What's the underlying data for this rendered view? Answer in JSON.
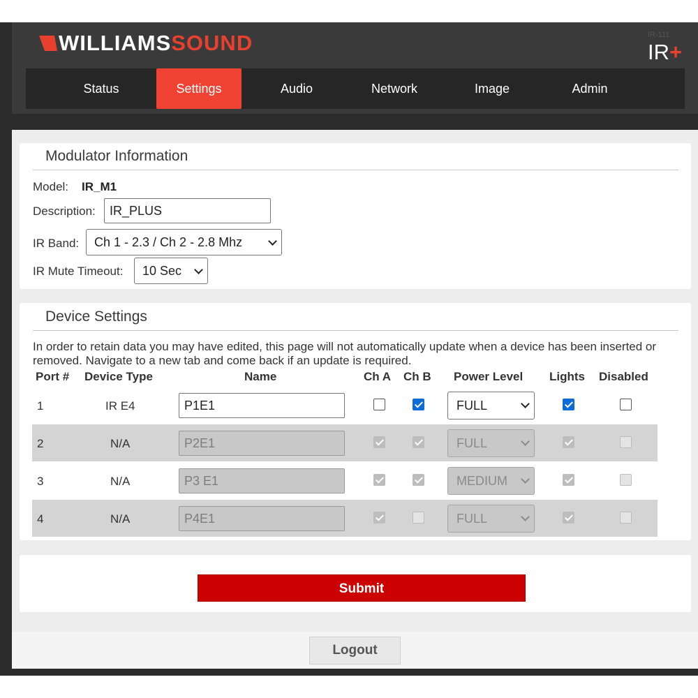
{
  "brand": {
    "logo_word1": "WILLIAMS",
    "logo_word2": "SOUND",
    "device_small": "IR-111",
    "device_badge": "IR",
    "device_badge_plus": "+",
    "accent_color": "#ef4233"
  },
  "nav": {
    "tabs": [
      {
        "label": "Status",
        "active": false
      },
      {
        "label": "Settings",
        "active": true
      },
      {
        "label": "Audio",
        "active": false
      },
      {
        "label": "Network",
        "active": false
      },
      {
        "label": "Image",
        "active": false
      },
      {
        "label": "Admin",
        "active": false
      }
    ]
  },
  "modulator": {
    "title": "Modulator Information",
    "model_label": "Model:",
    "model_value": "IR_M1",
    "description_label": "Description:",
    "description_value": "IR_PLUS",
    "ir_band_label": "IR Band:",
    "ir_band_value": "Ch 1 - 2.3 / Ch 2 - 2.8 Mhz",
    "mute_timeout_label": "IR Mute Timeout:",
    "mute_timeout_value": "10 Sec"
  },
  "devices": {
    "title": "Device Settings",
    "note": "In order to retain data you may have edited, this page will not automatically update when a device has been inserted or removed. Navigate to a new tab and come back if an update is required.",
    "headers": [
      "Port #",
      "Device Type",
      "Name",
      "Ch A",
      "Ch B",
      "Power Level",
      "Lights",
      "Disabled"
    ],
    "rows": [
      {
        "port": "1",
        "type": "IR E4",
        "name": "P1E1",
        "ch_a": false,
        "ch_b": true,
        "power": "FULL",
        "lights": true,
        "disabled": false,
        "editable": true
      },
      {
        "port": "2",
        "type": "N/A",
        "name": "P2E1",
        "ch_a": true,
        "ch_b": true,
        "power": "FULL",
        "lights": true,
        "disabled": false,
        "editable": false
      },
      {
        "port": "3",
        "type": "N/A",
        "name": "P3 E1",
        "ch_a": true,
        "ch_b": true,
        "power": "MEDIUM",
        "lights": true,
        "disabled": false,
        "editable": false
      },
      {
        "port": "4",
        "type": "N/A",
        "name": "P4E1",
        "ch_a": true,
        "ch_b": false,
        "power": "FULL",
        "lights": true,
        "disabled": false,
        "editable": false
      }
    ]
  },
  "actions": {
    "submit_label": "Submit",
    "logout_label": "Logout"
  }
}
